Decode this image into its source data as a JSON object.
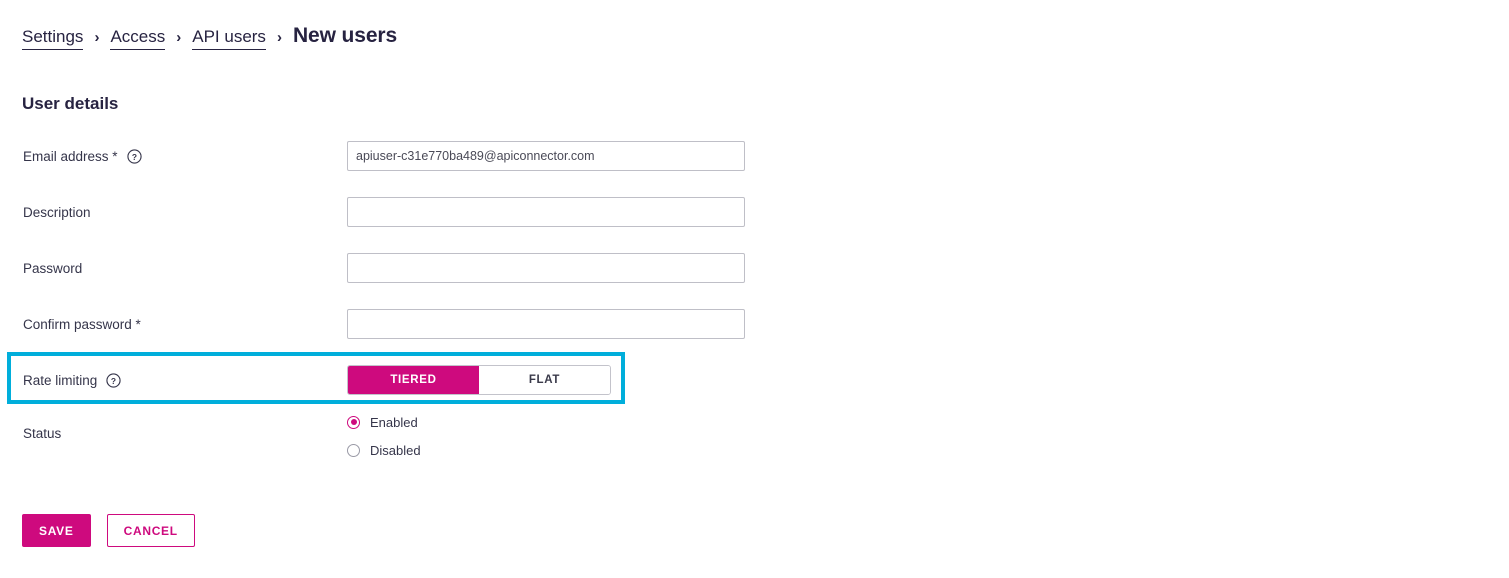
{
  "breadcrumb": {
    "separator": "›",
    "items": [
      {
        "label": "Settings",
        "current": false
      },
      {
        "label": "Access",
        "current": false
      },
      {
        "label": "API users",
        "current": false
      },
      {
        "label": "New users",
        "current": true
      }
    ]
  },
  "section": {
    "title": "User details"
  },
  "fields": {
    "email": {
      "label": "Email address *",
      "value": "apiuser-c31e770ba489@apiconnector.com",
      "help": "?"
    },
    "description": {
      "label": "Description",
      "value": ""
    },
    "password": {
      "label": "Password",
      "value": ""
    },
    "confirm_password": {
      "label": "Confirm password *",
      "value": ""
    },
    "rate_limiting": {
      "label": "Rate limiting",
      "help": "?",
      "options": [
        "TIERED",
        "FLAT"
      ],
      "selected": "TIERED"
    },
    "status": {
      "label": "Status",
      "options": [
        "Enabled",
        "Disabled"
      ],
      "selected": "Enabled"
    }
  },
  "actions": {
    "save_label": "SAVE",
    "cancel_label": "CANCEL"
  },
  "colors": {
    "accent": "#ce0a7e",
    "highlight": "#00aedb",
    "text": "#272341"
  }
}
